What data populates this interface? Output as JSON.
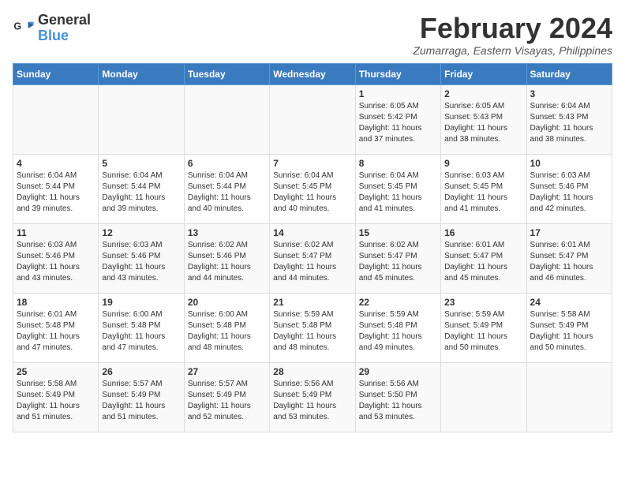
{
  "logo": {
    "text_general": "General",
    "text_blue": "Blue"
  },
  "title": {
    "month_year": "February 2024",
    "location": "Zumarraga, Eastern Visayas, Philippines"
  },
  "days_of_week": [
    "Sunday",
    "Monday",
    "Tuesday",
    "Wednesday",
    "Thursday",
    "Friday",
    "Saturday"
  ],
  "weeks": [
    [
      {
        "day": "",
        "info": ""
      },
      {
        "day": "",
        "info": ""
      },
      {
        "day": "",
        "info": ""
      },
      {
        "day": "",
        "info": ""
      },
      {
        "day": "1",
        "info": "Sunrise: 6:05 AM\nSunset: 5:42 PM\nDaylight: 11 hours\nand 37 minutes."
      },
      {
        "day": "2",
        "info": "Sunrise: 6:05 AM\nSunset: 5:43 PM\nDaylight: 11 hours\nand 38 minutes."
      },
      {
        "day": "3",
        "info": "Sunrise: 6:04 AM\nSunset: 5:43 PM\nDaylight: 11 hours\nand 38 minutes."
      }
    ],
    [
      {
        "day": "4",
        "info": "Sunrise: 6:04 AM\nSunset: 5:44 PM\nDaylight: 11 hours\nand 39 minutes."
      },
      {
        "day": "5",
        "info": "Sunrise: 6:04 AM\nSunset: 5:44 PM\nDaylight: 11 hours\nand 39 minutes."
      },
      {
        "day": "6",
        "info": "Sunrise: 6:04 AM\nSunset: 5:44 PM\nDaylight: 11 hours\nand 40 minutes."
      },
      {
        "day": "7",
        "info": "Sunrise: 6:04 AM\nSunset: 5:45 PM\nDaylight: 11 hours\nand 40 minutes."
      },
      {
        "day": "8",
        "info": "Sunrise: 6:04 AM\nSunset: 5:45 PM\nDaylight: 11 hours\nand 41 minutes."
      },
      {
        "day": "9",
        "info": "Sunrise: 6:03 AM\nSunset: 5:45 PM\nDaylight: 11 hours\nand 41 minutes."
      },
      {
        "day": "10",
        "info": "Sunrise: 6:03 AM\nSunset: 5:46 PM\nDaylight: 11 hours\nand 42 minutes."
      }
    ],
    [
      {
        "day": "11",
        "info": "Sunrise: 6:03 AM\nSunset: 5:46 PM\nDaylight: 11 hours\nand 43 minutes."
      },
      {
        "day": "12",
        "info": "Sunrise: 6:03 AM\nSunset: 5:46 PM\nDaylight: 11 hours\nand 43 minutes."
      },
      {
        "day": "13",
        "info": "Sunrise: 6:02 AM\nSunset: 5:46 PM\nDaylight: 11 hours\nand 44 minutes."
      },
      {
        "day": "14",
        "info": "Sunrise: 6:02 AM\nSunset: 5:47 PM\nDaylight: 11 hours\nand 44 minutes."
      },
      {
        "day": "15",
        "info": "Sunrise: 6:02 AM\nSunset: 5:47 PM\nDaylight: 11 hours\nand 45 minutes."
      },
      {
        "day": "16",
        "info": "Sunrise: 6:01 AM\nSunset: 5:47 PM\nDaylight: 11 hours\nand 45 minutes."
      },
      {
        "day": "17",
        "info": "Sunrise: 6:01 AM\nSunset: 5:47 PM\nDaylight: 11 hours\nand 46 minutes."
      }
    ],
    [
      {
        "day": "18",
        "info": "Sunrise: 6:01 AM\nSunset: 5:48 PM\nDaylight: 11 hours\nand 47 minutes."
      },
      {
        "day": "19",
        "info": "Sunrise: 6:00 AM\nSunset: 5:48 PM\nDaylight: 11 hours\nand 47 minutes."
      },
      {
        "day": "20",
        "info": "Sunrise: 6:00 AM\nSunset: 5:48 PM\nDaylight: 11 hours\nand 48 minutes."
      },
      {
        "day": "21",
        "info": "Sunrise: 5:59 AM\nSunset: 5:48 PM\nDaylight: 11 hours\nand 48 minutes."
      },
      {
        "day": "22",
        "info": "Sunrise: 5:59 AM\nSunset: 5:48 PM\nDaylight: 11 hours\nand 49 minutes."
      },
      {
        "day": "23",
        "info": "Sunrise: 5:59 AM\nSunset: 5:49 PM\nDaylight: 11 hours\nand 50 minutes."
      },
      {
        "day": "24",
        "info": "Sunrise: 5:58 AM\nSunset: 5:49 PM\nDaylight: 11 hours\nand 50 minutes."
      }
    ],
    [
      {
        "day": "25",
        "info": "Sunrise: 5:58 AM\nSunset: 5:49 PM\nDaylight: 11 hours\nand 51 minutes."
      },
      {
        "day": "26",
        "info": "Sunrise: 5:57 AM\nSunset: 5:49 PM\nDaylight: 11 hours\nand 51 minutes."
      },
      {
        "day": "27",
        "info": "Sunrise: 5:57 AM\nSunset: 5:49 PM\nDaylight: 11 hours\nand 52 minutes."
      },
      {
        "day": "28",
        "info": "Sunrise: 5:56 AM\nSunset: 5:49 PM\nDaylight: 11 hours\nand 53 minutes."
      },
      {
        "day": "29",
        "info": "Sunrise: 5:56 AM\nSunset: 5:50 PM\nDaylight: 11 hours\nand 53 minutes."
      },
      {
        "day": "",
        "info": ""
      },
      {
        "day": "",
        "info": ""
      }
    ]
  ]
}
